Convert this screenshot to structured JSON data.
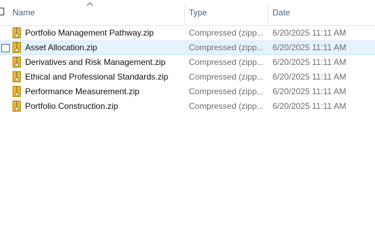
{
  "columns": {
    "name": "Name",
    "type": "Type",
    "date": "Date"
  },
  "files": [
    {
      "name": "Portfolio Management Pathway.zip",
      "type": "Compressed (zipp...",
      "date": "6/20/2025 11:11 AM"
    },
    {
      "name": "Asset Allocation.zip",
      "type": "Compressed (zipp...",
      "date": "6/20/2025 11:11 AM"
    },
    {
      "name": "Derivatives and Risk Management.zip",
      "type": "Compressed (zipp...",
      "date": "6/20/2025 11:11 AM"
    },
    {
      "name": "Ethical and Professional Standards.zip",
      "type": "Compressed (zipp...",
      "date": "6/20/2025 11:11 AM"
    },
    {
      "name": "Performance Measurement.zip",
      "type": "Compressed (zipp...",
      "date": "6/20/2025 11:11 AM"
    },
    {
      "name": "Portfolio Construction.zip",
      "type": "Compressed (zipp...",
      "date": "6/20/2025 11:11 AM"
    }
  ],
  "hovered_row": "Asset Allocation.zip",
  "colors": {
    "hover_bg": "#e5f3ff",
    "hover_border": "#cce8ff",
    "header_text": "#4c607a",
    "zip_folder": "#e8b730",
    "zip_zipper": "#8a7a4a"
  },
  "icons": {
    "sort": "sort-ascending-icon",
    "file": "zip-folder-icon"
  }
}
